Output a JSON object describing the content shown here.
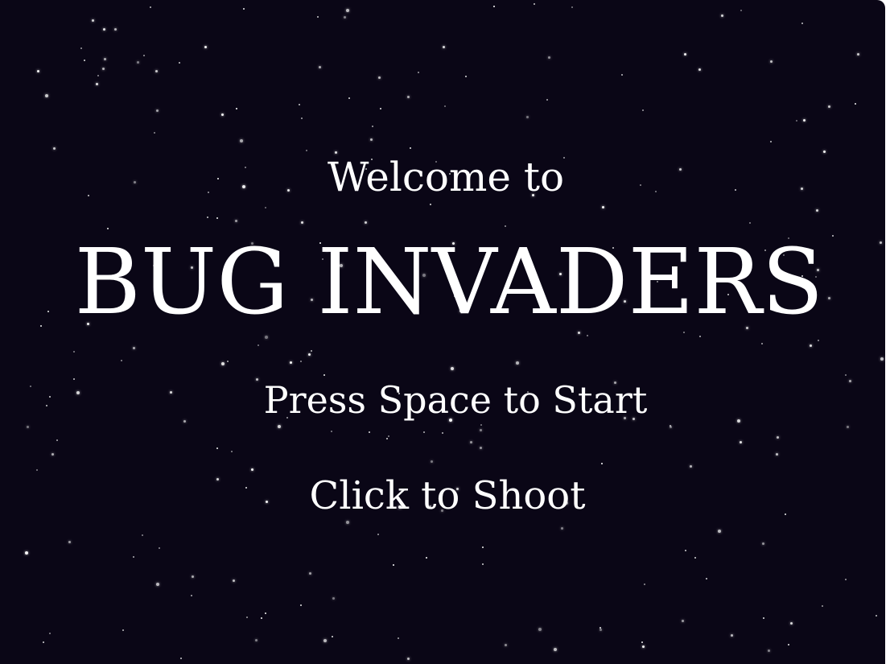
{
  "game": {
    "welcome": "Welcome to",
    "title": "BUG INVADERS",
    "start_instruction": "Press Space to Start",
    "shoot_instruction": "Click to Shoot"
  },
  "colors": {
    "background": "#0a0616",
    "text": "#ffffff",
    "stars": "#ffffff"
  }
}
